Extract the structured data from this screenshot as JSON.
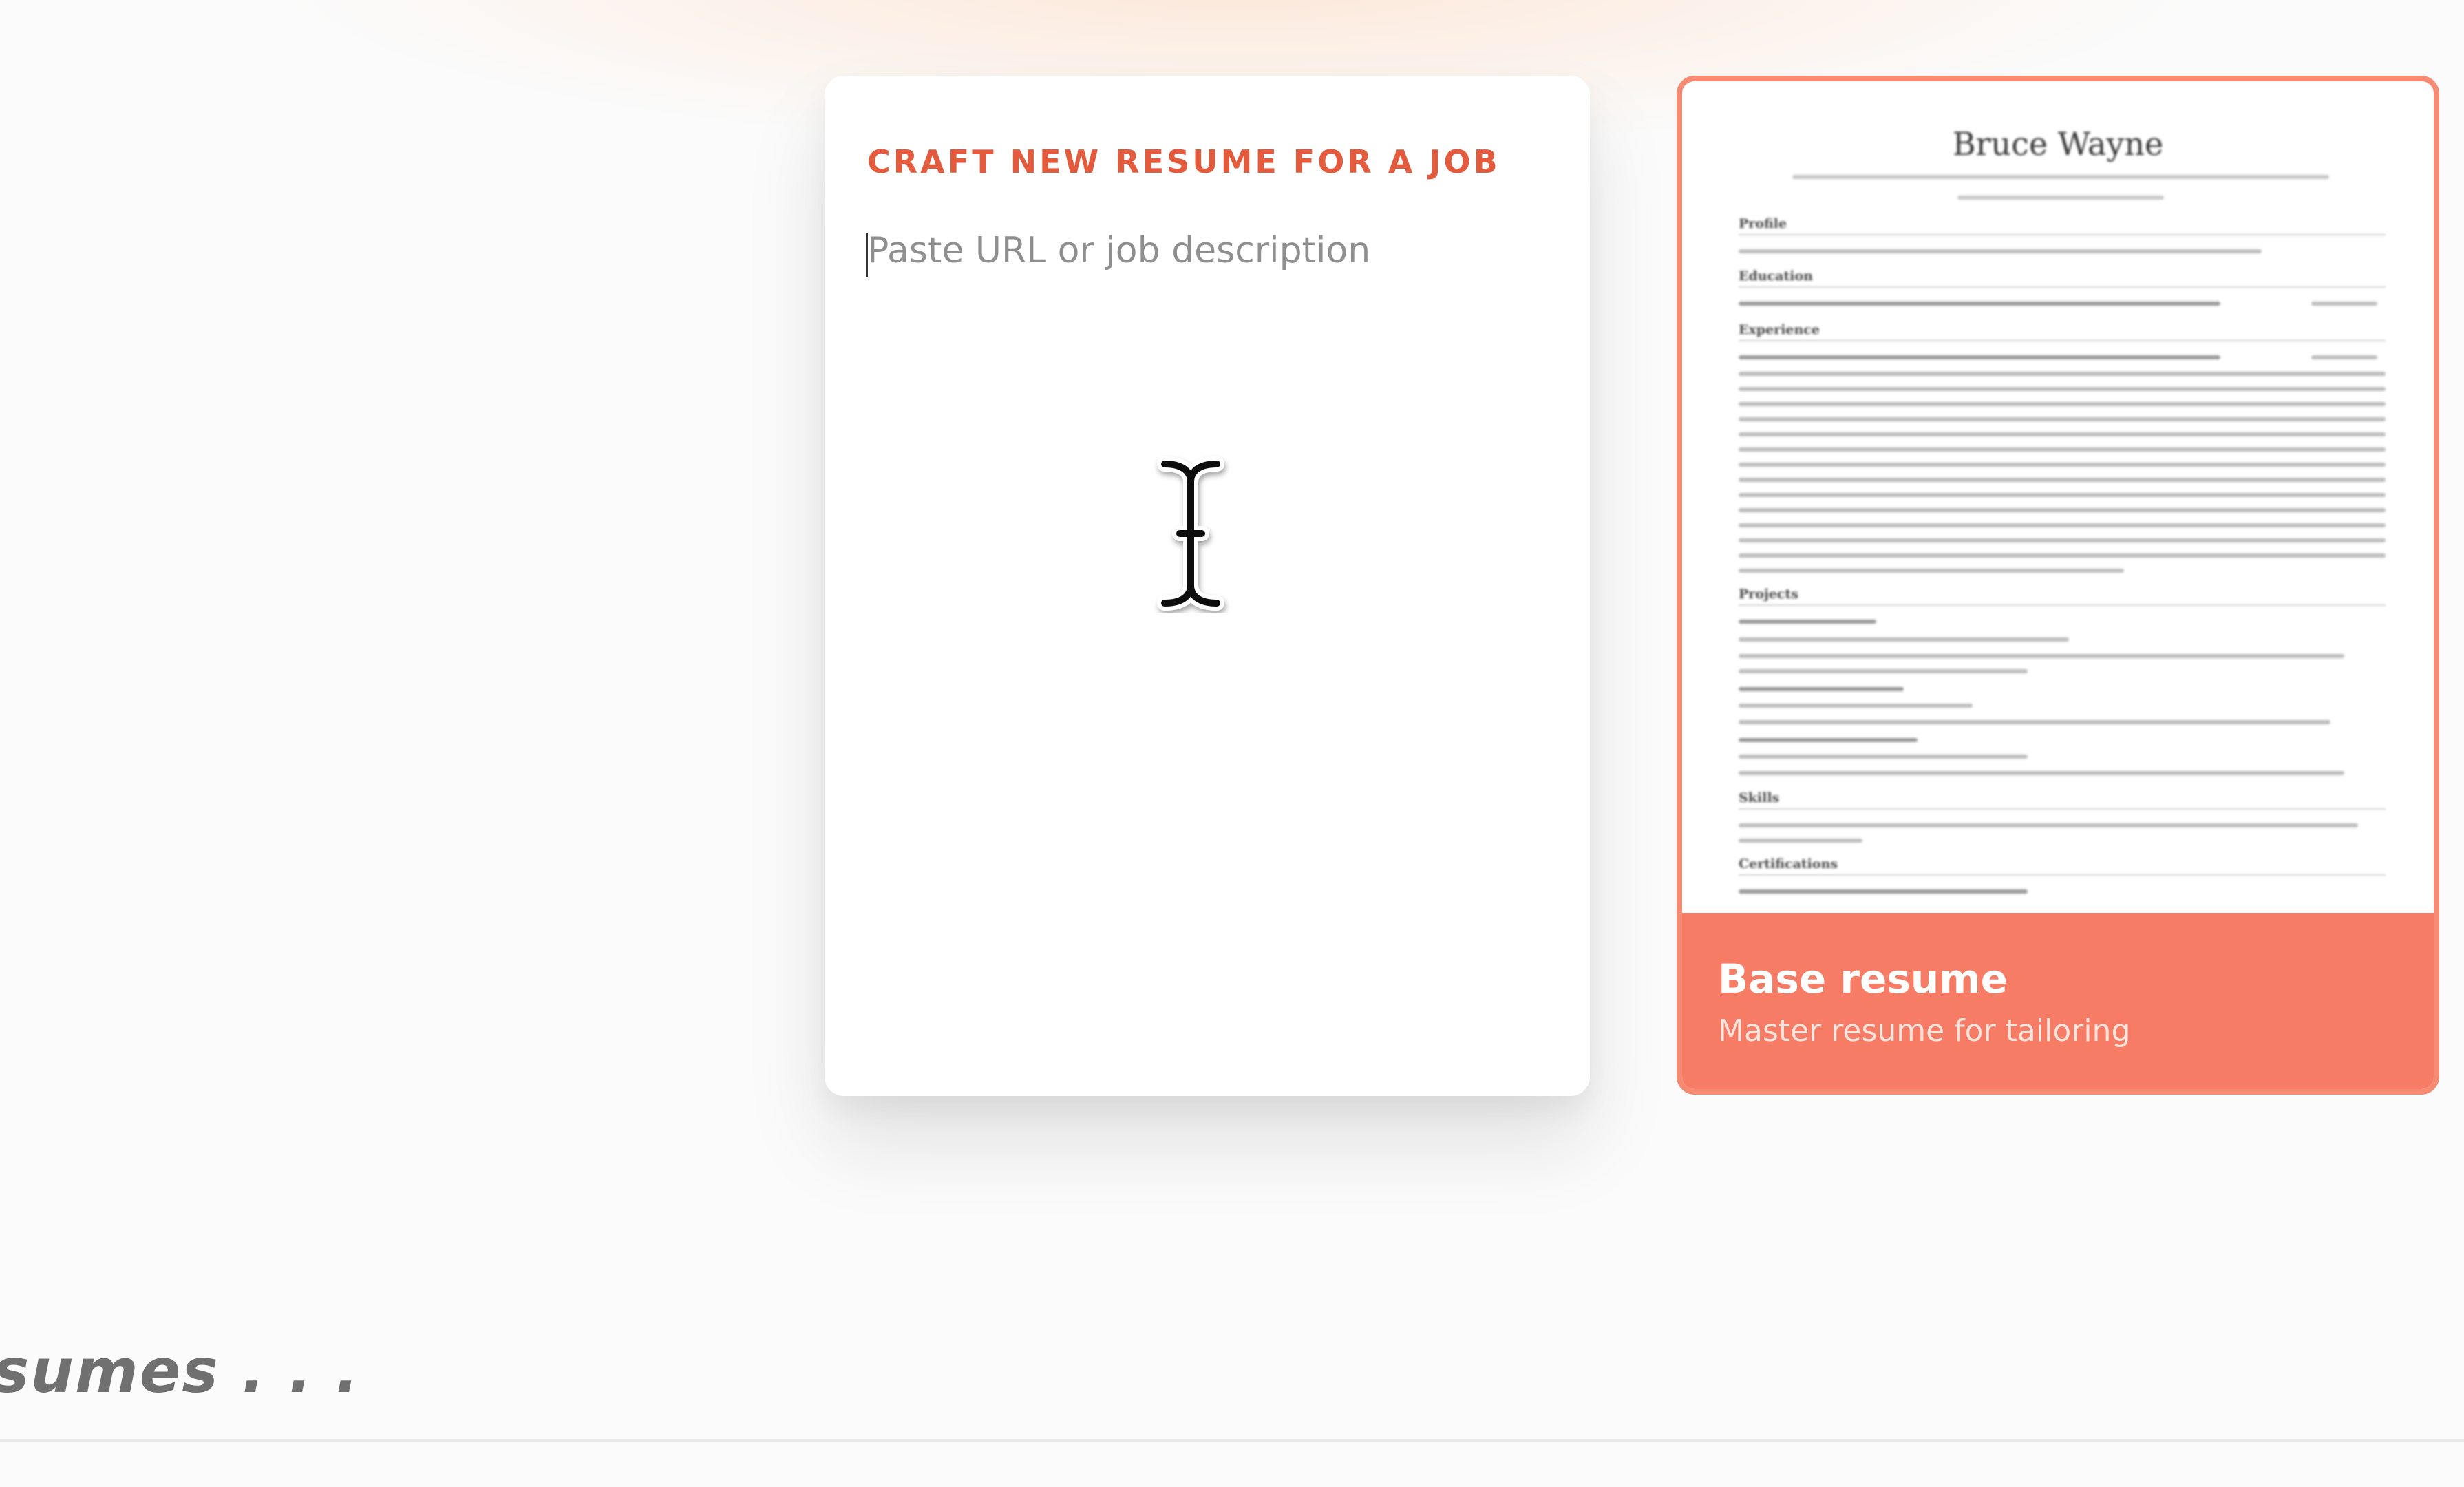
{
  "craft_card": {
    "title": "CRAFT NEW RESUME FOR A JOB",
    "input_placeholder": "Paste URL or job description",
    "input_value": ""
  },
  "base_resume_card": {
    "title": "Base resume",
    "subtitle": "Master resume for tailoring",
    "preview": {
      "name": "Bruce Wayne",
      "sections": [
        "Profile",
        "Education",
        "Experience",
        "Projects",
        "Skills",
        "Certifications"
      ]
    }
  },
  "recent_section": {
    "heading_fragment": "sumes . . ."
  },
  "colors": {
    "accent": "#e35a3c",
    "card_highlight": "#f77c65",
    "card_border": "#f58b73"
  },
  "icons": {
    "cursor": "text-cursor-ibeam-icon"
  }
}
